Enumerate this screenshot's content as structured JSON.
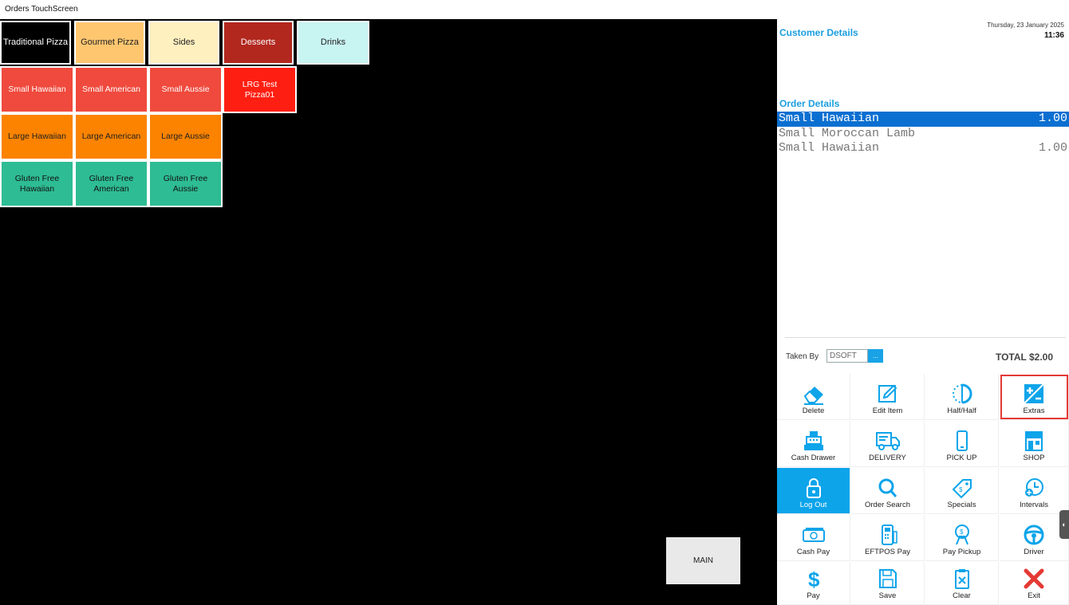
{
  "window": {
    "title": "Orders TouchScreen"
  },
  "categories": [
    {
      "label": "Traditional Pizza",
      "bg": "#000000",
      "fg": "#ffffff"
    },
    {
      "label": "Gourmet Pizza",
      "bg": "#ffc670",
      "fg": "#222222"
    },
    {
      "label": "Sides",
      "bg": "#fff0c0",
      "fg": "#222222"
    },
    {
      "label": "Desserts",
      "bg": "#b2281f",
      "fg": "#ffffff"
    },
    {
      "label": "Drinks",
      "bg": "#c8f4f2",
      "fg": "#222222"
    }
  ],
  "products": [
    {
      "label": "Small Hawaiian",
      "bg": "#ef4a3d",
      "fg": "#ffffff"
    },
    {
      "label": "Small American",
      "bg": "#ef4a3d",
      "fg": "#ffffff"
    },
    {
      "label": "Small Aussie",
      "bg": "#ef4a3d",
      "fg": "#ffffff"
    },
    {
      "label": "LRG Test Pizza01",
      "bg": "#ff1f12",
      "fg": "#ffffff"
    },
    {
      "label": "Large Hawaiian",
      "bg": "#fb8300",
      "fg": "#222222"
    },
    {
      "label": "Large American",
      "bg": "#fb8300",
      "fg": "#222222"
    },
    {
      "label": "Large Aussie",
      "bg": "#fb8300",
      "fg": "#222222"
    },
    {
      "label": "Gluten Free Hawaiian",
      "bg": "#2ebc94",
      "fg": "#111111"
    },
    {
      "label": "Gluten Free American",
      "bg": "#2ebc94",
      "fg": "#111111"
    },
    {
      "label": "Gluten Free Aussie",
      "bg": "#2ebc94",
      "fg": "#111111"
    }
  ],
  "main_button": "MAIN",
  "customer": {
    "title": "Customer Details",
    "date": "Thursday, 23 January 2025",
    "time": "11:36"
  },
  "order": {
    "title": "Order Details",
    "items": [
      {
        "name": "Small Hawaiian",
        "qty": "1.00"
      },
      {
        "name": "Small Moroccan Lamb",
        "qty": ""
      },
      {
        "name": "Small Hawaiian",
        "qty": "1.00"
      }
    ]
  },
  "taken_by": {
    "label": "Taken By",
    "value": "DSOFT",
    "dropdown": "..."
  },
  "total": "TOTAL  $2.00",
  "actions": [
    {
      "label": "Delete",
      "icon": "eraser-icon"
    },
    {
      "label": "Edit Item",
      "icon": "edit-icon"
    },
    {
      "label": "Half/Half",
      "icon": "half-circle-icon"
    },
    {
      "label": "Extras",
      "icon": "plus-minus-icon"
    },
    {
      "label": "Cash Drawer",
      "icon": "cash-register-icon"
    },
    {
      "label": "DELIVERY",
      "icon": "truck-icon"
    },
    {
      "label": "PICK UP",
      "icon": "phone-icon"
    },
    {
      "label": "SHOP",
      "icon": "store-icon"
    },
    {
      "label": "Log Out",
      "icon": "lock-icon"
    },
    {
      "label": "Order Search",
      "icon": "search-icon"
    },
    {
      "label": "Specials",
      "icon": "tag-icon"
    },
    {
      "label": "Intervals",
      "icon": "clock-plus-icon"
    },
    {
      "label": "Cash Pay",
      "icon": "cash-icon"
    },
    {
      "label": "EFTPOS Pay",
      "icon": "eftpos-icon"
    },
    {
      "label": "Pay Pickup",
      "icon": "pay-pickup-icon"
    },
    {
      "label": "Driver",
      "icon": "steering-wheel-icon"
    },
    {
      "label": "Pay",
      "icon": "dollar-icon"
    },
    {
      "label": "Save",
      "icon": "save-icon"
    },
    {
      "label": "Clear",
      "icon": "clear-icon"
    },
    {
      "label": "Exit",
      "icon": "close-icon"
    }
  ],
  "colors": {
    "accent": "#0da4ea",
    "selected_row": "#0a6fd1",
    "highlight": "#e53935"
  }
}
